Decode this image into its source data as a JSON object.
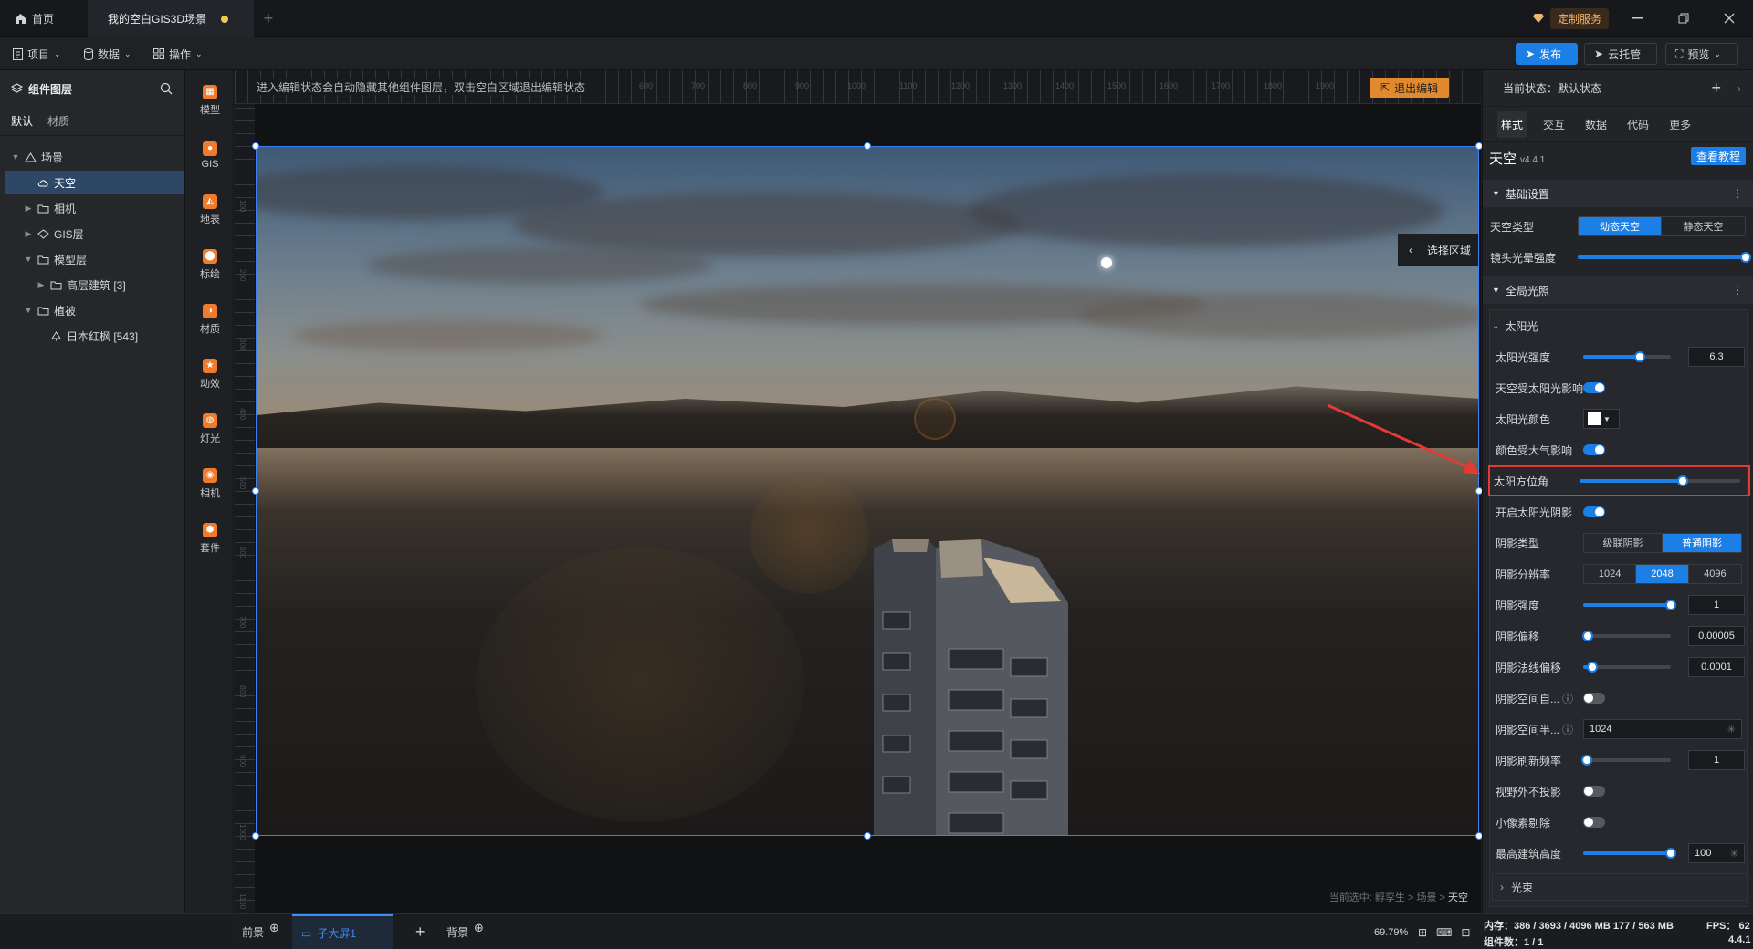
{
  "titlebar": {
    "home_label": "首页",
    "doc_title": "我的空白GIS3D场景",
    "custom_service": "定制服务"
  },
  "menubar": {
    "project": "项目",
    "data": "数据",
    "operate": "操作",
    "publish": "发布",
    "cloud": "云托管",
    "preview": "预览"
  },
  "left_panel": {
    "title": "组件图层",
    "tabs": [
      "默认",
      "材质"
    ],
    "tree": [
      {
        "label": "场景",
        "icon": "scene-icon",
        "indent": 0,
        "caret": "▼",
        "selected": false
      },
      {
        "label": "天空",
        "icon": "sky-icon",
        "indent": 1,
        "caret": "",
        "selected": true
      },
      {
        "label": "相机",
        "icon": "folder-icon",
        "indent": 1,
        "caret": "▶",
        "selected": false
      },
      {
        "label": "GIS层",
        "icon": "gis-layer-icon",
        "indent": 1,
        "caret": "▶",
        "selected": false
      },
      {
        "label": "模型层",
        "icon": "folder-icon",
        "indent": 1,
        "caret": "▼",
        "selected": false
      },
      {
        "label": "高层建筑 [3]",
        "icon": "folder-icon",
        "indent": 2,
        "caret": "▶",
        "selected": false
      },
      {
        "label": "植被",
        "icon": "folder-icon",
        "indent": 1,
        "caret": "▼",
        "selected": false
      },
      {
        "label": "日本红枫 [543]",
        "icon": "tree-icon",
        "indent": 2,
        "caret": "",
        "selected": false
      }
    ]
  },
  "tools": [
    "模型",
    "GIS",
    "地表",
    "标绘",
    "材质",
    "动效",
    "灯光",
    "相机",
    "套件"
  ],
  "canvas": {
    "hint": "进入编辑状态会自动隐藏其他组件图层，双击空白区域退出编辑状态",
    "exit_edit": "退出编辑",
    "select_area": "选择区域",
    "breadcrumb_prefix": "当前选中: 孵孪生 > 场景 > ",
    "breadcrumb_current": "天空",
    "ruler_top_labels": [
      "600",
      "700",
      "800",
      "900",
      "1000",
      "1100",
      "1200",
      "1300",
      "1400",
      "1500",
      "1600",
      "1700",
      "1800",
      "1900"
    ],
    "ruler_left_labels": [
      "100",
      "200",
      "300",
      "400",
      "500",
      "600",
      "700",
      "800",
      "900",
      "1000",
      "1100"
    ]
  },
  "bottombar": {
    "foreground": "前景",
    "sub_screen": "子大屏1",
    "background": "背景",
    "zoom": "69.79%"
  },
  "right_panel": {
    "state_label": "当前状态：默认状态",
    "tabs": [
      "样式",
      "交互",
      "数据",
      "代码",
      "更多"
    ],
    "component_name": "天空",
    "version": "v4.4.1",
    "tutorial": "查看教程",
    "basic_title": "基础设置",
    "sky_type_label": "天空类型",
    "sky_type_options": [
      "动态天空",
      "静态天空"
    ],
    "sky_type_selected": 0,
    "lens_flare_label": "镜头光晕强度",
    "lens_flare_value": 1.0,
    "global_light_title": "全局光照",
    "sunlight_title": "太阳光",
    "sun_intensity_label": "太阳光强度",
    "sun_intensity_value": "6.3",
    "sun_intensity_frac": 0.65,
    "sky_affected_label": "天空受太阳光影响",
    "sun_color_label": "太阳光颜色",
    "color_atmo_label": "颜色受大气影响",
    "sun_azimuth_label": "太阳方位角",
    "sun_azimuth_frac": 0.64,
    "sun_shadow_label": "开启太阳光阴影",
    "shadow_type_label": "阴影类型",
    "shadow_type_options": [
      "级联阴影",
      "普通阴影"
    ],
    "shadow_type_selected": 1,
    "shadow_res_label": "阴影分辨率",
    "shadow_res_options": [
      "1024",
      "2048",
      "4096"
    ],
    "shadow_res_selected": 1,
    "shadow_strength_label": "阴影强度",
    "shadow_strength_value": "1",
    "shadow_strength_frac": 1.0,
    "shadow_bias_label": "阴影偏移",
    "shadow_bias_value": "0.00005",
    "shadow_bias_frac": 0.05,
    "shadow_normal_bias_label": "阴影法线偏移",
    "shadow_normal_bias_value": "0.0001",
    "shadow_normal_bias_frac": 0.1,
    "shadow_space_auto_label": "阴影空间自...",
    "shadow_space_radius_label": "阴影空间半...",
    "shadow_space_radius_value": "1024",
    "shadow_refresh_label": "阴影刷新频率",
    "shadow_refresh_value": "1",
    "shadow_refresh_frac": 0.04,
    "no_cast_outside_label": "视野外不投影",
    "small_pixel_cull_label": "小像素剔除",
    "max_building_label": "最高建筑高度",
    "max_building_value": "100",
    "max_building_frac": 1.0,
    "beam_title": "光束"
  },
  "footer": {
    "memory": "内存：386 / 3693 / 4096 MB  177 / 563 MB",
    "fps": "FPS： 62",
    "components": "组件数：1 / 1",
    "version": "4.4.1"
  },
  "colors": {
    "accent": "#1c7fe6",
    "highlight": "#e53935",
    "exit_edit": "#e0892f"
  }
}
